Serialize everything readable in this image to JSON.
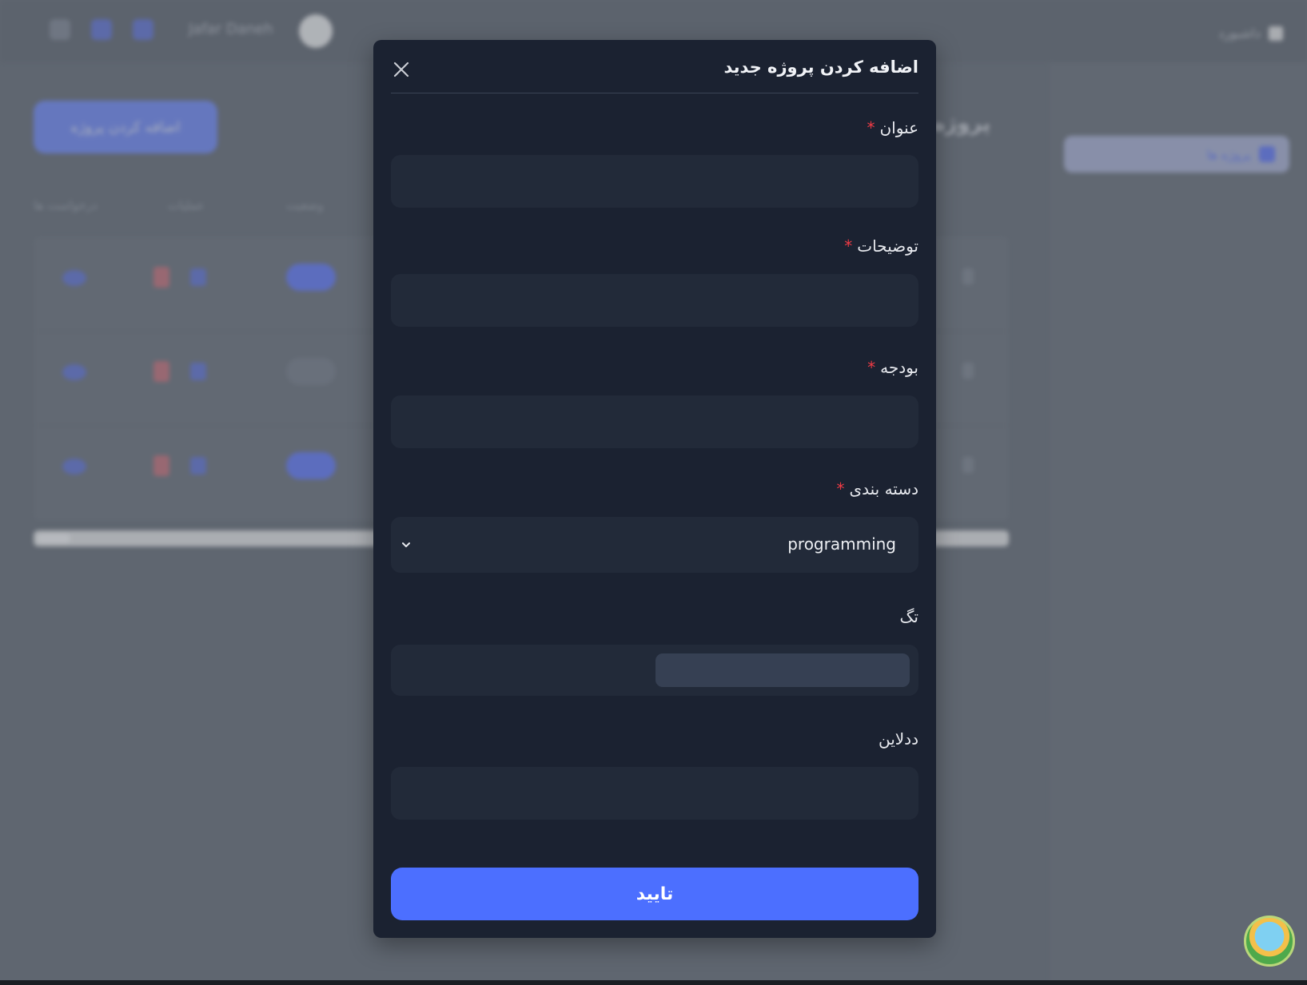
{
  "background": {
    "user_name": "Jafar Daneh",
    "brand": "داشبورد",
    "sidebar_item": "پروژه ها",
    "add_button": "اضافه کردن پروژه",
    "page_heading": "پروژه ها",
    "table_headers": [
      "درخواست ها",
      "عملیات",
      "وضعیت"
    ]
  },
  "modal": {
    "title": "اضافه کردن پروژه جدید",
    "required_mark": "*",
    "fields": {
      "title": {
        "label": "عنوان",
        "value": ""
      },
      "description": {
        "label": "توضیحات",
        "value": ""
      },
      "budget": {
        "label": "بودجه",
        "value": ""
      },
      "category": {
        "label": "دسته بندی",
        "value": "programming"
      },
      "tag": {
        "label": "تگ"
      },
      "deadline": {
        "label": "ددلاین",
        "value": ""
      }
    },
    "submit_label": "تایید"
  },
  "colors": {
    "accent": "#4c6fff",
    "modal_bg": "#1b2231",
    "field_bg": "#222a39",
    "required": "#ef3b45"
  }
}
